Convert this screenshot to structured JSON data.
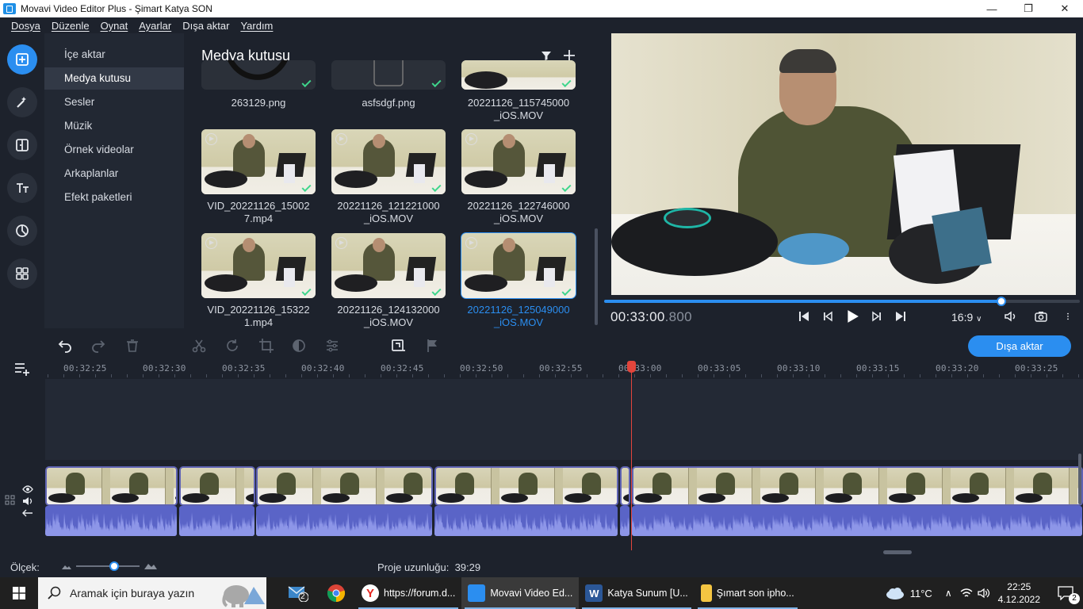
{
  "window": {
    "title": "Movavi Video Editor Plus - Şimart Katya SON",
    "minimize": "—",
    "maximize": "❐",
    "close": "✕"
  },
  "menu": [
    "Dosya",
    "Düzenle",
    "Oynat",
    "Ayarlar",
    "Dışa aktar",
    "Yardım"
  ],
  "sidebar": {
    "items": [
      {
        "label": "İçe aktar"
      },
      {
        "label": "Medya kutusu",
        "active": true
      },
      {
        "label": "Sesler"
      },
      {
        "label": "Müzik"
      },
      {
        "label": "Örnek videolar"
      },
      {
        "label": "Arkaplanlar"
      },
      {
        "label": "Efekt paketleri"
      }
    ]
  },
  "media": {
    "title": "Medya kutusu",
    "items": [
      {
        "name": "263129.png",
        "kind": "image"
      },
      {
        "name": "asfsdgf.png",
        "kind": "image"
      },
      {
        "name": "20221126_115745000_iOS.MOV",
        "line1": "20221126_115745000",
        "line2": "_iOS.MOV",
        "kind": "video"
      },
      {
        "line1": "VID_20221126_15002",
        "line2": "7.mp4",
        "kind": "video"
      },
      {
        "line1": "20221126_121221000",
        "line2": "_iOS.MOV",
        "kind": "video"
      },
      {
        "line1": "20221126_122746000",
        "line2": "_iOS.MOV",
        "kind": "video"
      },
      {
        "line1": "VID_20221126_15322",
        "line2": "1.mp4",
        "kind": "video"
      },
      {
        "line1": "20221126_124132000",
        "line2": "_iOS.MOV",
        "kind": "video"
      },
      {
        "line1": "20221126_125049000",
        "line2": "_iOS.MOV",
        "kind": "video",
        "selected": true
      }
    ]
  },
  "player": {
    "time_main": "00:33:00",
    "time_ms": ".800",
    "progress": 0.835,
    "ratio": "16:9"
  },
  "timeline": {
    "export_label": "Dışa aktar",
    "ticks": [
      "00:32:25",
      "00:32:30",
      "00:32:35",
      "00:32:40",
      "00:32:45",
      "00:32:50",
      "00:32:55",
      "00:33:00",
      "00:33:05",
      "00:33:10",
      "00:33:15",
      "00:33:20",
      "00:33:25"
    ]
  },
  "status": {
    "scale_label": "Ölçek:",
    "zoom_level": 0.6,
    "project_length_label": "Proje uzunluğu:",
    "project_length": "39:29"
  },
  "taskbar": {
    "search_placeholder": "Aramak için buraya yazın",
    "mail_badge": "2",
    "apps": [
      {
        "label": "https://forum.d...",
        "color": "#ffffff"
      },
      {
        "label": "Movavi Video Ed...",
        "color": "#2b8ef0",
        "active": true
      },
      {
        "label": "Katya Sunum [U...",
        "color": "#2b5797"
      },
      {
        "label": "Şımart son ipho...",
        "color": "#f4c542"
      }
    ],
    "weather": "11°C",
    "time": "22:25",
    "date": "4.12.2022",
    "notif_badge": "2"
  },
  "colors": {
    "accent": "#2b8ef0",
    "playhead": "#e2453c",
    "clip_border": "#5f63b3",
    "audio": "#5a64c7",
    "check": "#3fd68c"
  }
}
